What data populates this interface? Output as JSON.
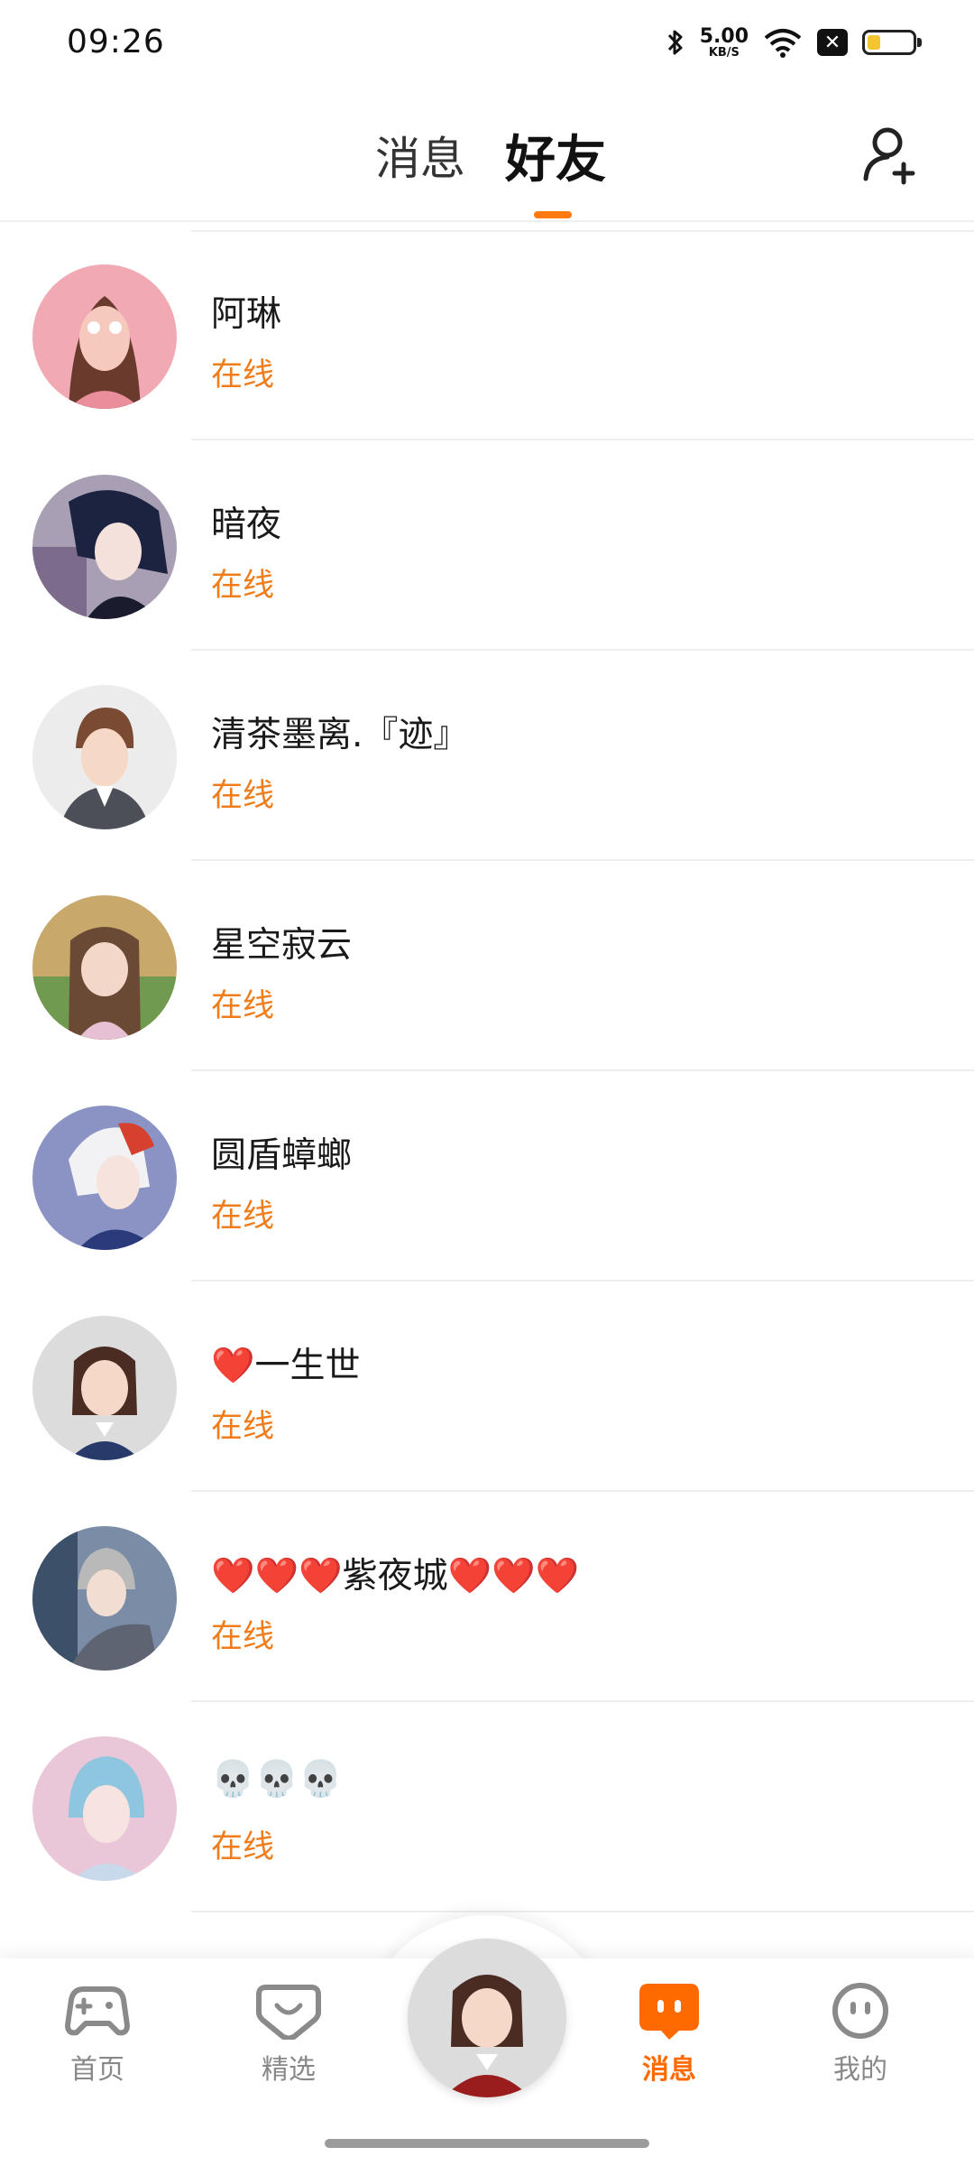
{
  "status_bar": {
    "time": "09:26",
    "net_speed_value": "5.00",
    "net_speed_unit": "KB/S",
    "battery_level": 0.25,
    "icons": [
      "bluetooth-icon",
      "wifi-icon",
      "close-box-icon",
      "battery-icon"
    ]
  },
  "header": {
    "tabs": [
      {
        "label": "消息",
        "active": false
      },
      {
        "label": "好友",
        "active": true
      }
    ],
    "accent_color": "#ff7a10",
    "right_icon": "add-friend-icon"
  },
  "friends": [
    {
      "name": "阿琳",
      "status": "在线"
    },
    {
      "name": "暗夜",
      "status": "在线"
    },
    {
      "name": "清茶墨离.『迹』",
      "status": "在线"
    },
    {
      "name": "星空寂云",
      "status": "在线"
    },
    {
      "name": "圆盾蟑螂",
      "status": "在线"
    },
    {
      "name": "❤️一生世",
      "status": "在线"
    },
    {
      "name": "❤️❤️❤️紫夜城❤️❤️❤️",
      "status": "在线"
    },
    {
      "name": "💀💀💀",
      "status": "在线"
    }
  ],
  "bottom_nav": {
    "items": [
      {
        "label": "首页",
        "icon": "gamepad-icon",
        "active": false
      },
      {
        "label": "精选",
        "icon": "heart-chat-icon",
        "active": false
      },
      {
        "label": "消息",
        "icon": "message-icon",
        "active": true
      },
      {
        "label": "我的",
        "icon": "face-icon",
        "active": false
      }
    ],
    "active_color": "#ff6a00",
    "inactive_color": "#888888"
  }
}
